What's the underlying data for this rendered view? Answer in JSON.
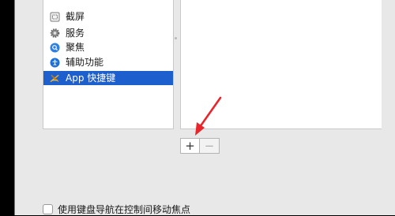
{
  "categories": [
    {
      "label": "截屏",
      "icon": "screenshot-icon"
    },
    {
      "label": "服务",
      "icon": "gear-icon"
    },
    {
      "label": "聚焦",
      "icon": "spotlight-search-icon"
    },
    {
      "label": "辅助功能",
      "icon": "accessibility-icon"
    },
    {
      "label": "App 快捷键",
      "icon": "app-shortcuts-icon",
      "selected": true
    }
  ],
  "buttons": {
    "add_label": "+",
    "remove_label": "−"
  },
  "keyboard_nav": {
    "label": "使用键盘导航在控制间移动焦点",
    "checked": false
  },
  "colors": {
    "selection": "#1d5fcc",
    "annotation_arrow": "#e8252b"
  }
}
